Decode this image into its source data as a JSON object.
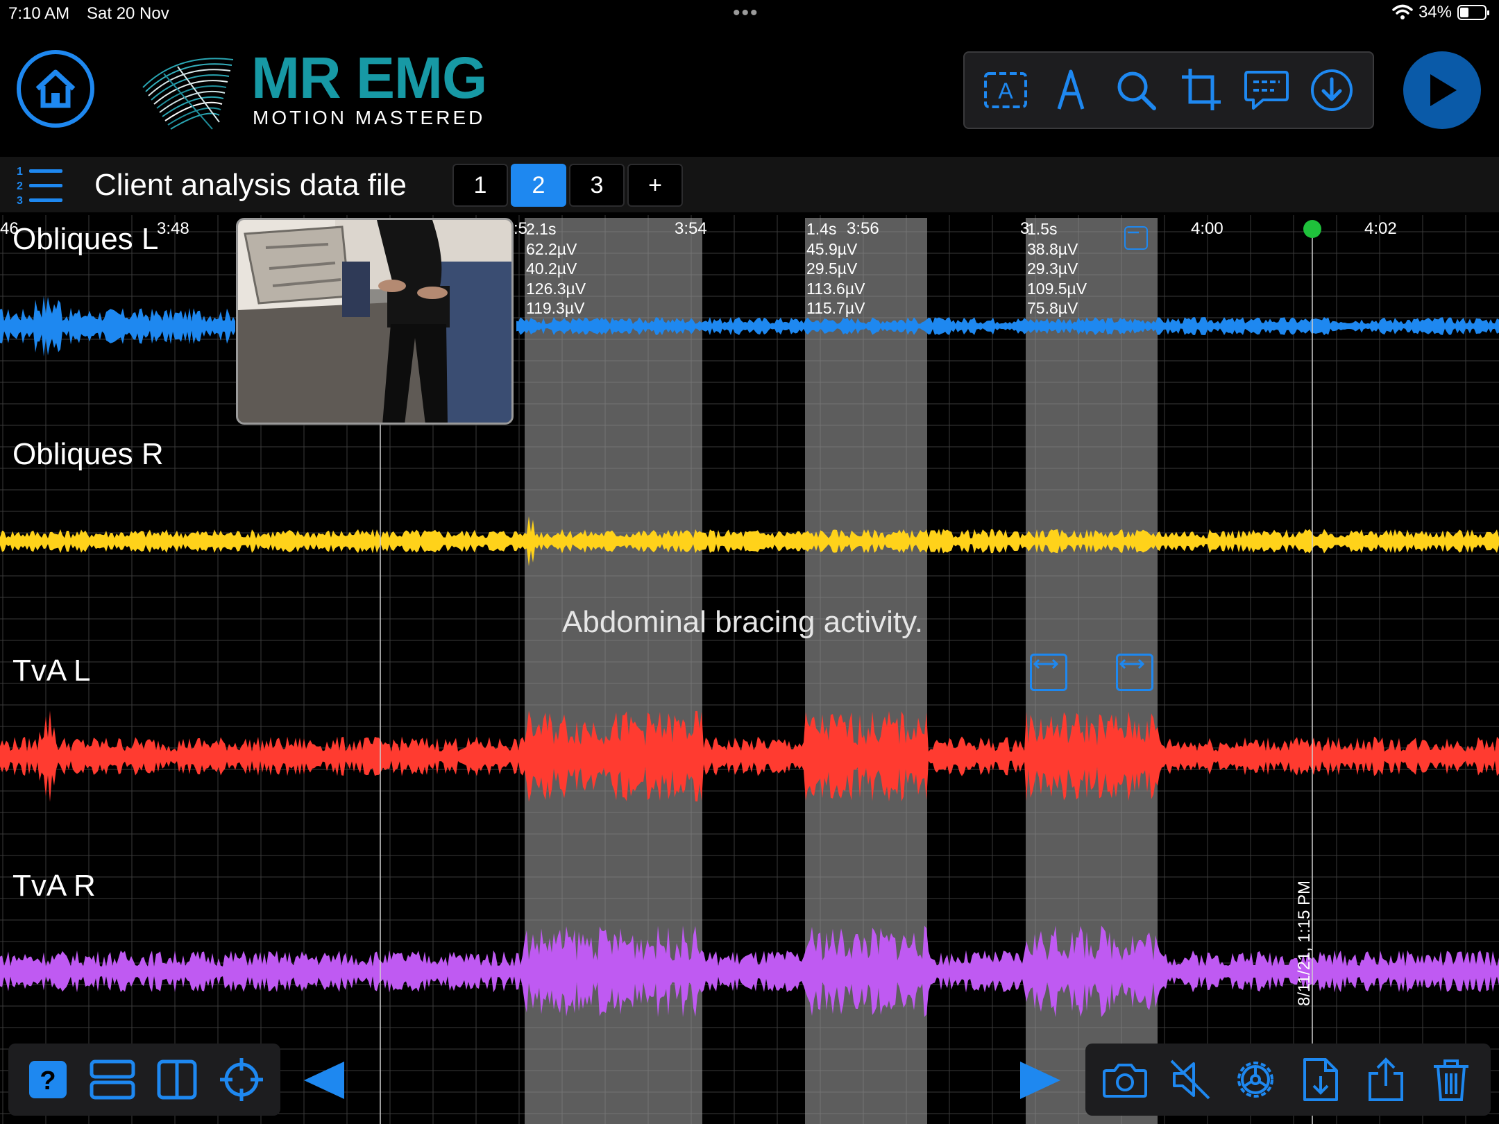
{
  "status_bar": {
    "time": "7:10 AM",
    "date": "Sat 20 Nov",
    "battery": "34%",
    "battery_level": 0.34
  },
  "header": {
    "brand": "MR EMG",
    "tagline": "MOTION MASTERED"
  },
  "toolbar_icons": [
    "text-label-icon",
    "pen-icon",
    "search-icon",
    "crop-icon",
    "comment-icon",
    "download-icon"
  ],
  "file": {
    "title": "Client analysis data file",
    "pages": [
      "1",
      "2",
      "3",
      "+"
    ],
    "active_page": "2"
  },
  "timeline": {
    "ticks": [
      "46",
      "3:48",
      ":5",
      "3:54",
      "3:56",
      "3",
      "4:00",
      "4:02"
    ]
  },
  "channels": [
    {
      "label": "Obliques L",
      "color": "#1e88f0"
    },
    {
      "label": "Obliques R",
      "color": "#ffd21a"
    },
    {
      "label": "TvA L",
      "color": "#ff3b30"
    },
    {
      "label": "TvA R",
      "color": "#bf5af2"
    }
  ],
  "selections": [
    {
      "duration": "2.1s",
      "values": [
        "62.2µV",
        "40.2µV",
        "126.3µV",
        "119.3µV"
      ]
    },
    {
      "duration": "1.4s",
      "values": [
        "45.9µV",
        "29.5µV",
        "113.6µV",
        "115.7µV"
      ]
    },
    {
      "duration": "1.5s",
      "values": [
        "38.8µV",
        "29.3µV",
        "109.5µV",
        "75.8µV"
      ]
    }
  ],
  "annotation": "Abdominal bracing activity.",
  "recording_timestamp": "8/11/21, 1:15 PM",
  "bottom_left_icons": [
    "help-icon",
    "rows-layout-icon",
    "columns-layout-icon",
    "crosshair-icon"
  ],
  "bottom_right_icons": [
    "camera-icon",
    "mute-icon",
    "settings-icon",
    "file-import-icon",
    "share-icon",
    "trash-icon"
  ]
}
